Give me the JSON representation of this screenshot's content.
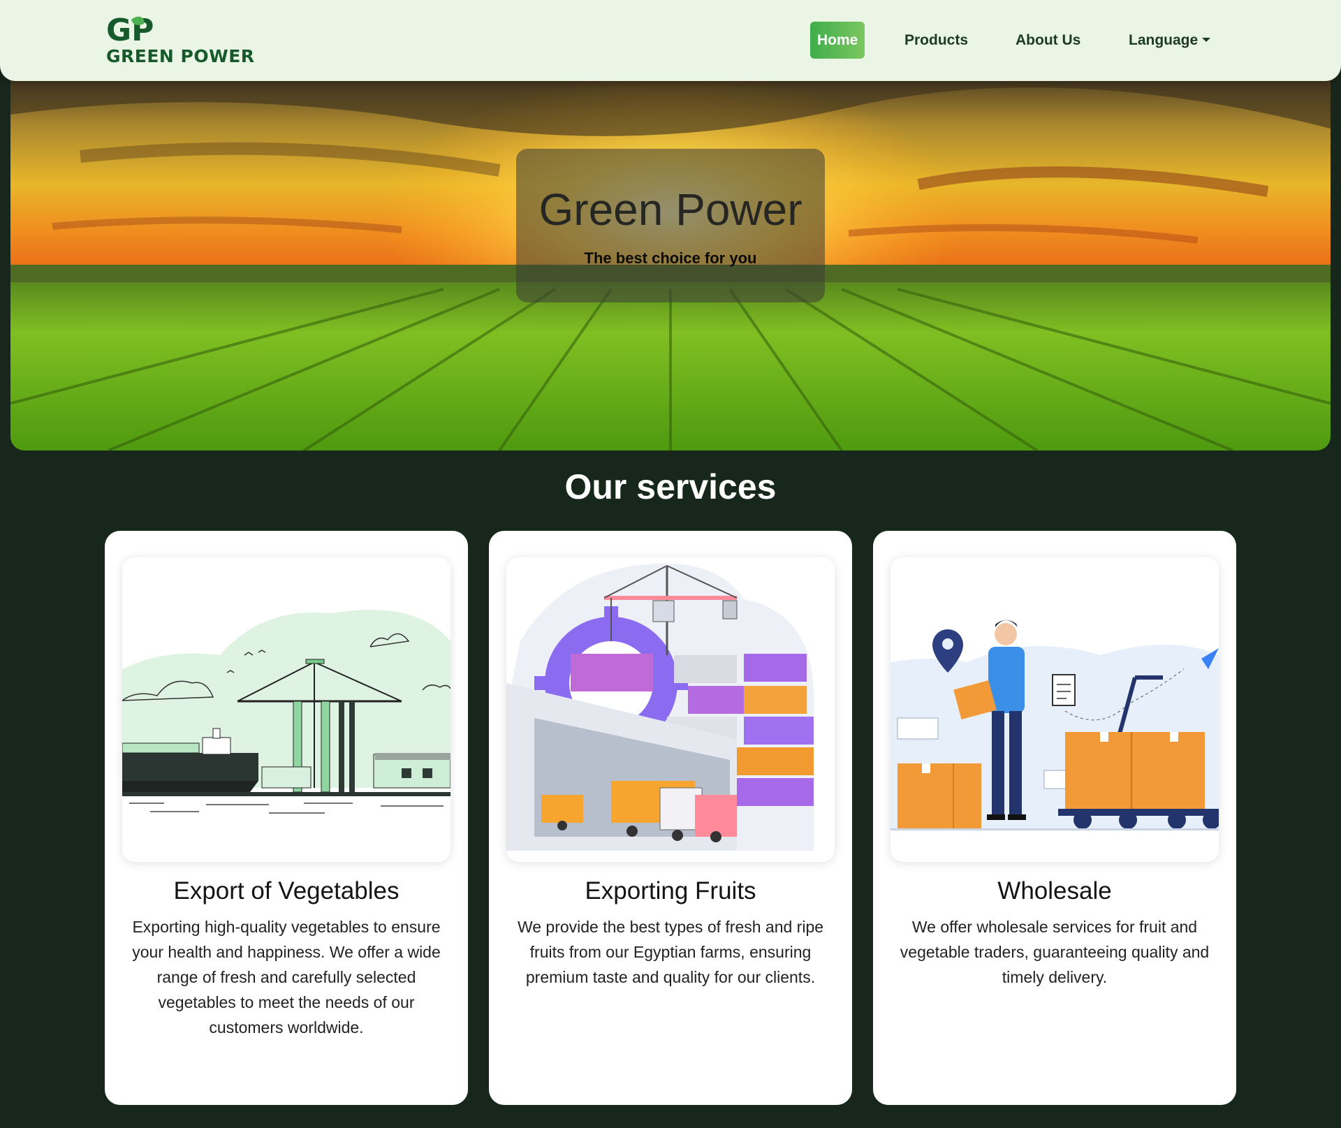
{
  "brand": {
    "logo_letters": "GP",
    "name": "GREEN POWER"
  },
  "nav": {
    "items": [
      {
        "label": "Home",
        "active": true
      },
      {
        "label": "Products",
        "active": false
      },
      {
        "label": "About Us",
        "active": false
      },
      {
        "label": "Language",
        "active": false,
        "dropdown": true
      }
    ]
  },
  "hero": {
    "title": "Green Power",
    "subtitle": "The best choice for you"
  },
  "services": {
    "heading": "Our services",
    "cards": [
      {
        "title": "Export of Vegetables",
        "text": "Exporting high-quality vegetables to ensure your health and happiness. We offer a wide range of fresh and carefully selected vegetables to meet the needs of our customers worldwide.",
        "icon": "port-ship-crane-illustration"
      },
      {
        "title": "Exporting Fruits",
        "text": "We provide the best types of fresh and ripe fruits from our Egyptian farms, ensuring premium taste and quality for our clients.",
        "icon": "container-logistics-illustration"
      },
      {
        "title": "Wholesale",
        "text": "We offer wholesale services for fruit and vegetable traders, guaranteeing quality and timely delivery.",
        "icon": "delivery-man-boxes-illustration"
      }
    ]
  },
  "colors": {
    "page_bg": "#18271c",
    "navbar_bg": "#eaf5e6",
    "brand_green": "#16592b",
    "active_nav_start": "#3fad4b",
    "active_nav_end": "#7cc660",
    "card_bg": "#ffffff"
  }
}
